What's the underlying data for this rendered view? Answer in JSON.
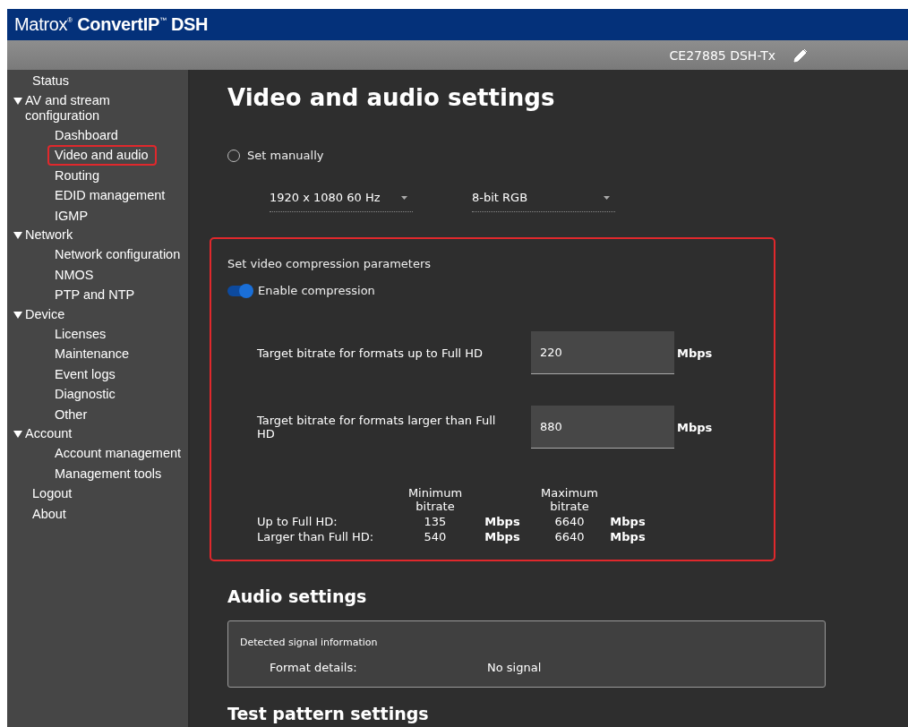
{
  "header": {
    "logo": "Matrox$^{®}$ **ConvertIP**$^{™}$ **DSH**"
  },
  "device_bar": {
    "device_name": "CE27885 DSH-Tx"
  },
  "sidebar": {
    "items": [
      {
        "label": "Status",
        "highlighted": false
      },
      {
        "label": "AV and stream configuration",
        "expanded": true,
        "children": [
          {
            "label": "Dashboard",
            "highlighted": false
          },
          {
            "label": "Video and audio",
            "highlighted": true
          },
          {
            "label": "Routing",
            "highlighted": false
          },
          {
            "label": "EDID management",
            "highlighted": false
          },
          {
            "label": "IGMP",
            "highlighted": false
          }
        ]
      },
      {
        "label": "Network",
        "expanded": true,
        "children": [
          {
            "label": "Network configuration",
            "highlighted": false
          },
          {
            "label": "NMOS",
            "highlighted": false
          },
          {
            "label": "PTP and NTP",
            "highlighted": false
          }
        ]
      },
      {
        "label": "Device",
        "expanded": true,
        "children": [
          {
            "label": "Licenses",
            "highlighted": false
          },
          {
            "label": "Maintenance",
            "highlighted": false
          },
          {
            "label": "Event logs",
            "highlighted": false
          },
          {
            "label": "Diagnostic",
            "highlighted": false
          },
          {
            "label": "Other",
            "highlighted": false
          }
        ]
      },
      {
        "label": "Account",
        "expanded": true,
        "children": [
          {
            "label": "Account management",
            "highlighted": false
          },
          {
            "label": "Management tools",
            "highlighted": false
          }
        ]
      },
      {
        "label": "Logout",
        "highlighted": false
      },
      {
        "label": "About",
        "highlighted": false
      }
    ]
  },
  "page": {
    "title": "Video and audio settings",
    "manual": {
      "label": "Set manually",
      "selected": false
    },
    "dropdowns": [
      {
        "value": "1920 x 1080 60 Hz"
      },
      {
        "value": "8-bit RGB"
      }
    ],
    "compression": {
      "highlighted": true,
      "heading": "Set video compression parameters",
      "toggle": {
        "label": "Enable compression",
        "on": true
      },
      "fields": [
        {
          "label": "Target bitrate for formats up to Full HD",
          "value": "220",
          "unit": "Mbps"
        },
        {
          "label": "Target bitrate for formats larger than Full HD",
          "value": "880",
          "unit": "Mbps"
        }
      ],
      "table": {
        "columns": [
          "Minimum bitrate",
          "Maximum bitrate"
        ],
        "rows": [
          {
            "label": "Up to Full HD:",
            "min": "135",
            "min_unit": "Mbps",
            "max": "6640",
            "max_unit": "Mbps"
          },
          {
            "label": "Larger than Full HD:",
            "min": "540",
            "min_unit": "Mbps",
            "max": "6640",
            "max_unit": "Mbps"
          }
        ]
      }
    },
    "audio": {
      "title": "Audio settings",
      "box_title": "Detected signal information",
      "rows": [
        {
          "label": "Format details:",
          "value": "No signal"
        }
      ]
    },
    "next_title": "Test pattern settings"
  }
}
